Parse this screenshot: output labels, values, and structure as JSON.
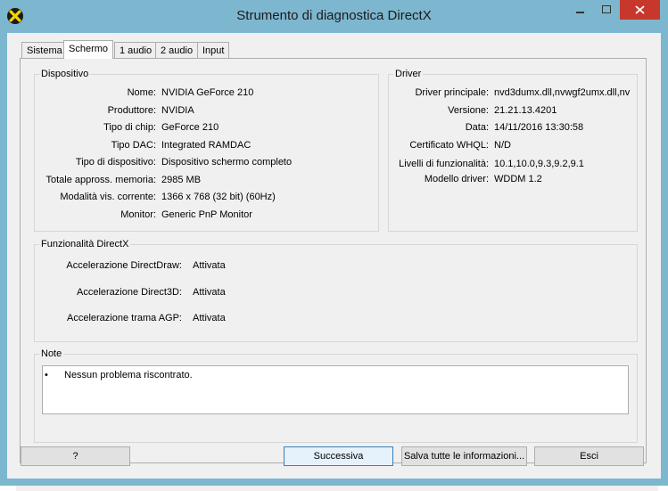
{
  "window": {
    "title": "Strumento di diagnostica DirectX",
    "controls": [
      "minimize",
      "maximize",
      "close"
    ]
  },
  "tabs": [
    {
      "label": "Sistema",
      "active": false
    },
    {
      "label": "Schermo",
      "active": true
    },
    {
      "label": "1 audio",
      "active": false
    },
    {
      "label": "2 audio",
      "active": false
    },
    {
      "label": "Input",
      "active": false
    }
  ],
  "device": {
    "title": "Dispositivo",
    "rows": [
      {
        "label": "Nome:",
        "value": "NVIDIA GeForce 210"
      },
      {
        "label": "Produttore:",
        "value": "NVIDIA"
      },
      {
        "label": "Tipo di chip:",
        "value": "GeForce 210"
      },
      {
        "label": "Tipo DAC:",
        "value": "Integrated RAMDAC"
      },
      {
        "label": "Tipo di dispositivo:",
        "value": "Dispositivo schermo completo"
      },
      {
        "label": "Totale appross. memoria:",
        "value": "2985 MB"
      },
      {
        "label": "Modalità vis. corrente:",
        "value": "1366 x 768 (32 bit) (60Hz)"
      },
      {
        "label": "Monitor:",
        "value": "Generic PnP Monitor"
      }
    ]
  },
  "driver": {
    "title": "Driver",
    "rows": [
      {
        "label": "Driver principale:",
        "value": "nvd3dumx.dll,nvwgf2umx.dll,nv"
      },
      {
        "label": "Versione:",
        "value": "21.21.13.4201"
      },
      {
        "label": "Data:",
        "value": "14/11/2016 13:30:58"
      },
      {
        "label": "Certificato WHQL:",
        "value": "N/D"
      },
      {
        "label": "Livelli di funzionalità:",
        "value": "10.1,10.0,9.3,9.2,9.1"
      },
      {
        "label": "Modello driver:",
        "value": "WDDM 1.2"
      }
    ]
  },
  "features": {
    "title": "Funzionalità DirectX",
    "rows": [
      {
        "label": "Accelerazione DirectDraw:",
        "value": "Attivata"
      },
      {
        "label": "Accelerazione Direct3D:",
        "value": "Attivata"
      },
      {
        "label": "Accelerazione trama AGP:",
        "value": "Attivata"
      }
    ]
  },
  "notes": {
    "title": "Note",
    "bullet": "•",
    "items": [
      "Nessun problema riscontrato."
    ]
  },
  "buttons": {
    "help": "?",
    "next": "Successiva",
    "save_all": "Salva tutte le informazioni...",
    "exit": "Esci"
  },
  "colors": {
    "frame": "#7db6cf",
    "close": "#c7372c",
    "panel": "#f0f0f0"
  }
}
